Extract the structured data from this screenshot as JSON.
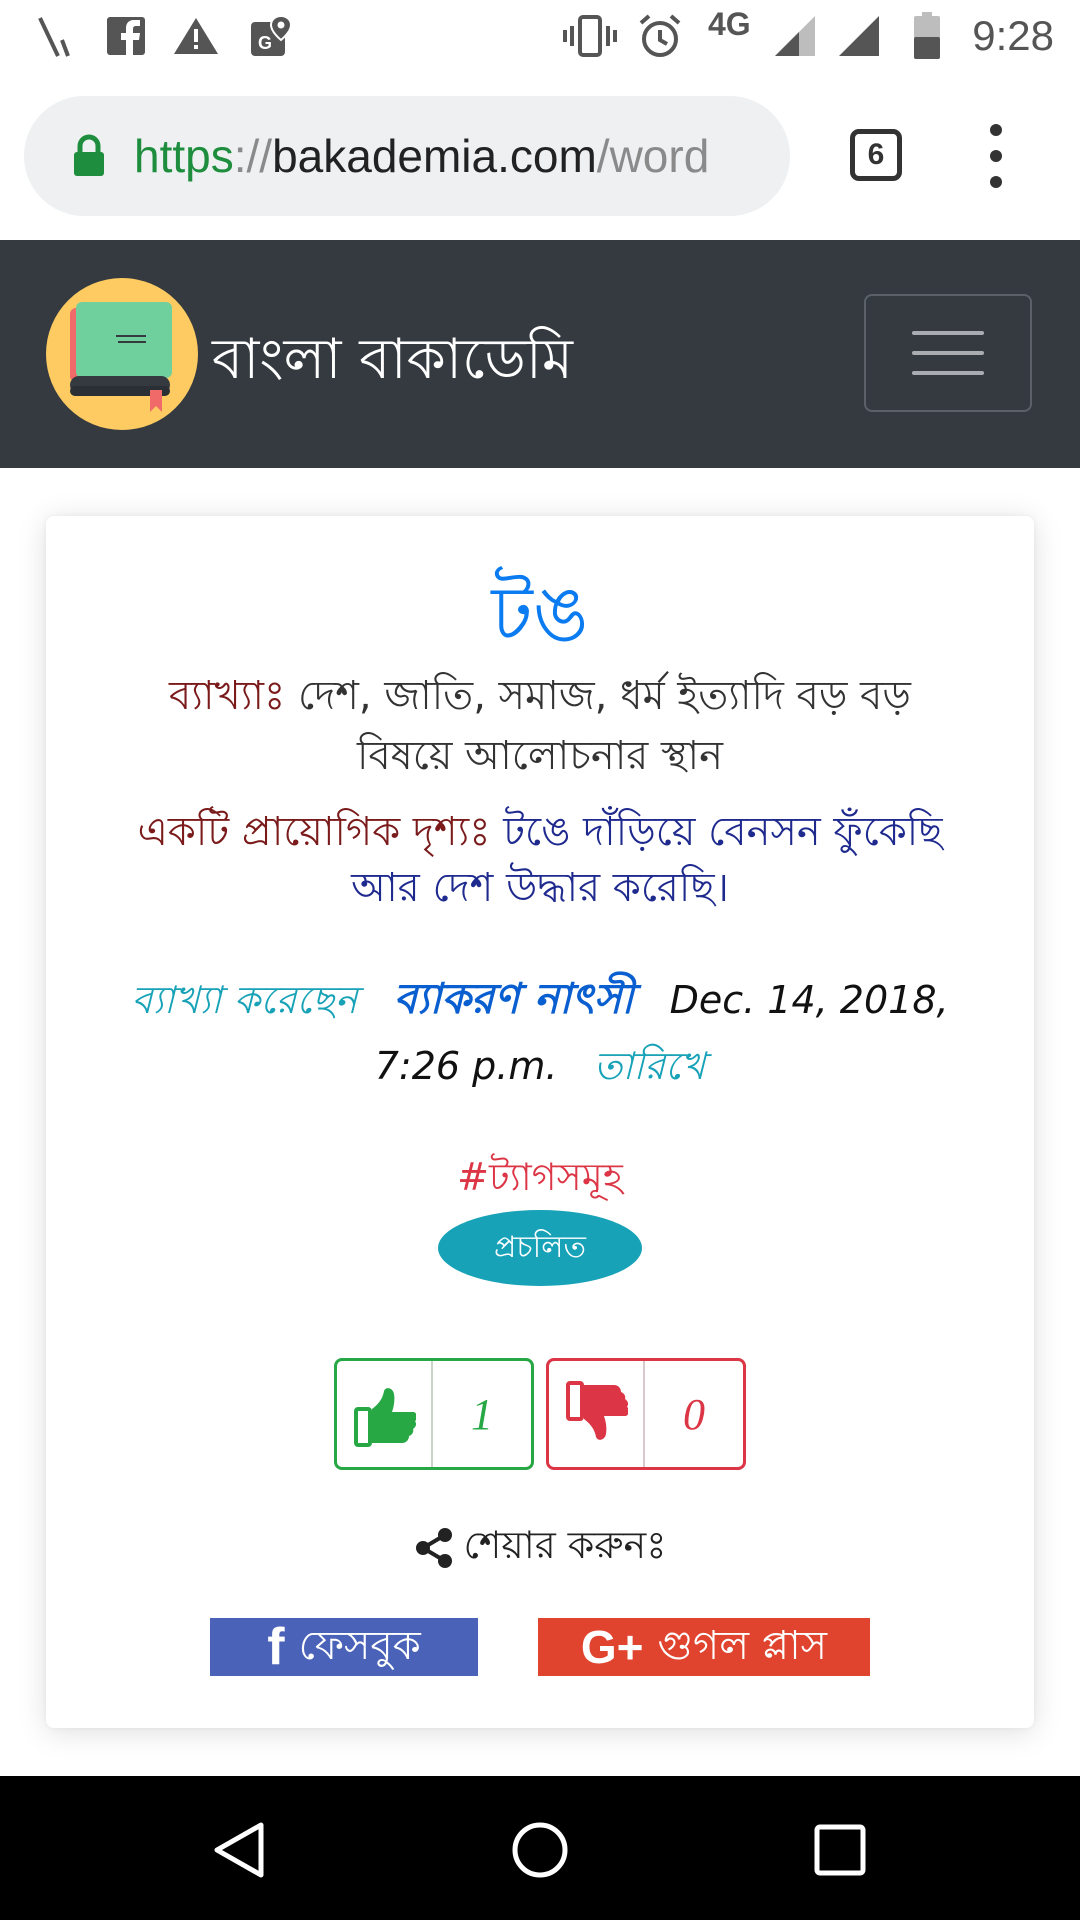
{
  "status_bar": {
    "time": "9:28",
    "network": "4G",
    "icons": [
      "signal-off-icon",
      "facebook-icon",
      "warning-icon",
      "maps-icon",
      "vibrate-icon",
      "alarm-icon",
      "cell-signal-icon",
      "cell-signal-icon",
      "battery-icon"
    ]
  },
  "browser": {
    "url_scheme": "https",
    "url_separator": "://",
    "url_host": "bakademia.com",
    "url_path": "/word",
    "tab_count": "6"
  },
  "site": {
    "brand": "বাংলা বাকাডেমি"
  },
  "entry": {
    "word": "টঙ",
    "definition_label": "ব্যাখ্যাঃ",
    "definition": "দেশ, জাতি, সমাজ, ধর্ম ইত্যাদি বড় বড় বিষয়ে আলোচনার স্থান",
    "example_label": "একটি প্রায়োগিক দৃশ্যঃ",
    "example": "টঙে দাঁড়িয়ে বেনসন ফুঁকেছি আর দেশ উদ্ধার করেছি।",
    "explained_by_label": "ব্যাখ্যা করেছেন",
    "author": "ব্যাকরণ নাৎসী",
    "date": "Dec. 14, 2018, 7:26 p.m.",
    "date_suffix": "তারিখে",
    "tags_heading": "#ট্যাগসমূহ",
    "tags": [
      "প্রচলিত"
    ],
    "upvotes": "1",
    "downvotes": "0",
    "share_label": "শেয়ার করুনঃ",
    "facebook_label": "ফেসবুক",
    "facebook_glyph": "f",
    "google_label": "গুগল প্লাস",
    "google_glyph": "G+"
  },
  "colors": {
    "navbar": "#343a40",
    "title": "#0a7bf0",
    "label": "#7a1a1a",
    "example": "#1f2a8f",
    "muted": "#17a2b8",
    "upvote": "#28a745",
    "downvote": "#dc3545",
    "facebook": "#4a63b8",
    "google": "#e0442f"
  }
}
